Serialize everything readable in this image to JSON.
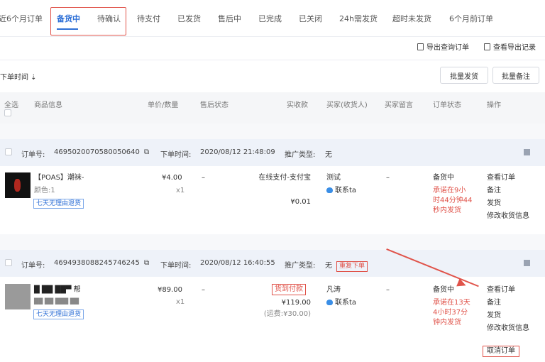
{
  "tabs": [
    {
      "label": "近6个月订单"
    },
    {
      "label": "备货中"
    },
    {
      "label": "待确认"
    },
    {
      "label": "待支付"
    },
    {
      "label": "已发货"
    },
    {
      "label": "售后中"
    },
    {
      "label": "已完成"
    },
    {
      "label": "已关闭"
    },
    {
      "label": "24h需发货"
    },
    {
      "label": "超时未发货"
    },
    {
      "label": "6个月前订单"
    }
  ],
  "toolbar": {
    "export_query": "导出查询订单",
    "view_export": "查看导出记录",
    "sort_label": "下单时间",
    "batch_ship": "批量发货",
    "batch_note": "批量备注"
  },
  "columns": {
    "select_all": "全选",
    "product": "商品信息",
    "price_qty": "单价/数量",
    "after_sale": "售后状态",
    "paid": "实收款",
    "buyer": "买家(收货人)",
    "buyer_msg": "买家留言",
    "order_status": "订单状态",
    "actions": "操作"
  },
  "orders": [
    {
      "order_no_label": "订单号:",
      "order_no": "4695020070580050640",
      "time_label": "下单时间:",
      "time": "2020/08/12 21:48:09",
      "promo_label": "推广类型:",
      "promo": "无",
      "product_name": "【POAS】潮袜-",
      "spec": "颜色:1",
      "badge": "七天无理由退货",
      "price": "¥4.00",
      "qty": "x1",
      "after_sale": "–",
      "pay_method": "在线支付-支付宝",
      "amount": "¥0.01",
      "buyer": "测试",
      "contact": "联系ta",
      "buyer_msg": "–",
      "status": "备货中",
      "status_note": "承诺在9小时44分钟44秒内发货",
      "actions": [
        "查看订单",
        "备注",
        "发货",
        "修改收货信息"
      ]
    },
    {
      "order_no_label": "订单号:",
      "order_no": "4694938088245746245",
      "time_label": "下单时间:",
      "time": "2020/08/12 16:40:55",
      "promo_label": "推广类型:",
      "promo": "无",
      "repeat_tag": "重复下单",
      "product_name": "█ ██ ██▀ 帮",
      "product_name2": "██ ██ ███ ██",
      "badge": "七天无理由退货",
      "price": "¥89.00",
      "qty": "x1",
      "after_sale": "–",
      "pay_method": "货到付款",
      "amount": "¥119.00",
      "shipping": "(运费:¥30.00)",
      "buyer": "凡涛",
      "contact": "联系ta",
      "buyer_msg": "–",
      "status": "备货中",
      "status_note": "承诺在13天4小时37分钟内发货",
      "actions": [
        "查看订单",
        "备注",
        "发货",
        "修改收货信息",
        "取消订单"
      ]
    }
  ],
  "colors": {
    "accent": "#2d6fd6",
    "highlight": "#e0534a"
  }
}
